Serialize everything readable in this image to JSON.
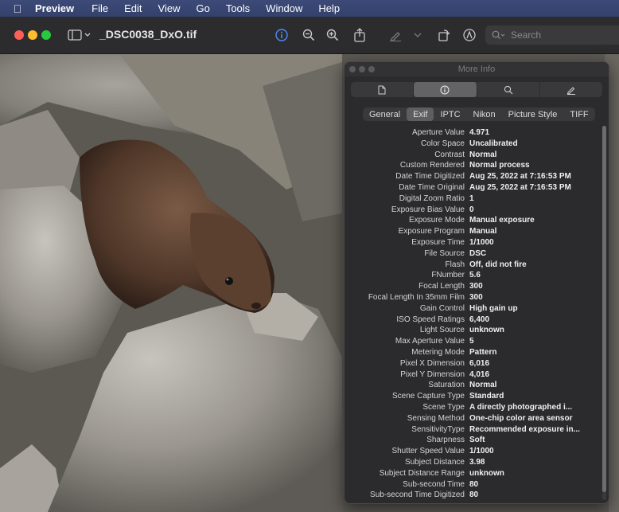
{
  "menubar": {
    "app": "Preview",
    "items": [
      "File",
      "Edit",
      "View",
      "Go",
      "Tools",
      "Window",
      "Help"
    ]
  },
  "toolbar": {
    "title": "_DSC0038_DxO.tif",
    "search_placeholder": "Search"
  },
  "panel": {
    "title": "More Info",
    "tabs": [
      "General",
      "Exif",
      "IPTC",
      "Nikon",
      "Picture Style",
      "TIFF"
    ],
    "active_tab": "Exif",
    "rows": [
      {
        "k": "Aperture Value",
        "v": "4.971"
      },
      {
        "k": "Color Space",
        "v": "Uncalibrated"
      },
      {
        "k": "Contrast",
        "v": "Normal"
      },
      {
        "k": "Custom Rendered",
        "v": "Normal process"
      },
      {
        "k": "Date Time Digitized",
        "v": "Aug 25, 2022 at 7:16:53 PM"
      },
      {
        "k": "Date Time Original",
        "v": "Aug 25, 2022 at 7:16:53 PM"
      },
      {
        "k": "Digital Zoom Ratio",
        "v": "1"
      },
      {
        "k": "Exposure Bias Value",
        "v": "0"
      },
      {
        "k": "Exposure Mode",
        "v": "Manual exposure"
      },
      {
        "k": "Exposure Program",
        "v": "Manual"
      },
      {
        "k": "Exposure Time",
        "v": "1/1000"
      },
      {
        "k": "File Source",
        "v": "DSC"
      },
      {
        "k": "Flash",
        "v": "Off, did not fire"
      },
      {
        "k": "FNumber",
        "v": "5.6"
      },
      {
        "k": "Focal Length",
        "v": "300"
      },
      {
        "k": "Focal Length In 35mm Film",
        "v": "300"
      },
      {
        "k": "Gain Control",
        "v": "High gain up"
      },
      {
        "k": "ISO Speed Ratings",
        "v": "6,400"
      },
      {
        "k": "Light Source",
        "v": "unknown"
      },
      {
        "k": "Max Aperture Value",
        "v": "5"
      },
      {
        "k": "Metering Mode",
        "v": "Pattern"
      },
      {
        "k": "Pixel X Dimension",
        "v": "6,016"
      },
      {
        "k": "Pixel Y Dimension",
        "v": "4,016"
      },
      {
        "k": "Saturation",
        "v": "Normal"
      },
      {
        "k": "Scene Capture Type",
        "v": "Standard"
      },
      {
        "k": "Scene Type",
        "v": "A directly photographed i..."
      },
      {
        "k": "Sensing Method",
        "v": "One-chip color area sensor"
      },
      {
        "k": "SensitivityType",
        "v": "Recommended exposure in..."
      },
      {
        "k": "Sharpness",
        "v": "Soft"
      },
      {
        "k": "Shutter Speed Value",
        "v": "1/1000"
      },
      {
        "k": "Subject Distance",
        "v": "3.98"
      },
      {
        "k": "Subject Distance Range",
        "v": "unknown"
      },
      {
        "k": "Sub-second Time",
        "v": "80"
      },
      {
        "k": "Sub-second Time Digitized",
        "v": "80"
      }
    ]
  },
  "colors": {
    "menubar": "#3d4a78",
    "accent_info": "#4a8cff",
    "panel_bg": "#2b2b2d"
  }
}
